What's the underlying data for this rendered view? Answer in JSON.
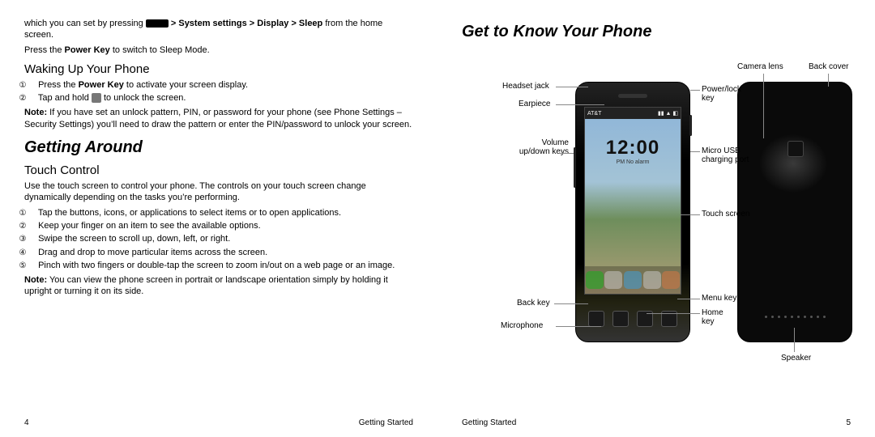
{
  "left": {
    "intro_pre": "which you can set by pressing ",
    "intro_path": " > System settings > Display > Sleep ",
    "intro_post": "from the home screen.",
    "press_power": "Press the Power Key to switch to Sleep Mode.",
    "wake_h": "Waking Up Your Phone",
    "wake1_pre": "Press the ",
    "wake1_bold": "Power Key",
    "wake1_post": " to activate your screen display.",
    "wake2_pre": "Tap and hold ",
    "wake2_post": " to unlock the screen.",
    "note_bold": "Note:",
    "note_body": " If you have set an unlock pattern, PIN, or password for your phone (see Phone Settings – Security Settings) you’ll need to draw the pattern or enter the PIN/password to unlock your screen.",
    "getting_around": "Getting Around",
    "touch_h": "Touch Control",
    "touch_p": "Use the touch screen to control your phone. The controls on your touch screen change dynamically depending on the tasks you’re performing.",
    "t1": "Tap the buttons, icons, or applications to select items or to open applications.",
    "t2": "Keep your finger on an item to see the available options.",
    "t3": "Swipe the screen to scroll up, down, left, or right.",
    "t4": "Drag and drop to move particular items across the screen.",
    "t5": "Pinch with two fingers or double-tap the screen to zoom in/out on a web page or an image.",
    "note2_bold": "Note:",
    "note2_body": " You can view the phone screen in portrait or landscape orientation simply by holding it upright or turning it on its side.",
    "pageno": "4",
    "footer": "Getting Started"
  },
  "right": {
    "title": "Get to Know Your Phone",
    "labels": {
      "headset": "Headset jack",
      "earpiece": "Earpiece",
      "volume": "Volume up/down keys",
      "back": "Back key",
      "mic": "Microphone",
      "power": "Power/lock key",
      "usb": "Micro USB charging port",
      "touch": "Touch screen",
      "menu": "Menu key",
      "home": "Home key",
      "camera": "Camera lens",
      "backcover": "Back cover",
      "speaker": "Speaker"
    },
    "phone_status": {
      "left": "AT&T",
      "right": "▮▮ ▲ ◧"
    },
    "phone_clock": "12:00",
    "phone_sub": "PM                           No alarm",
    "footer": "Getting Started",
    "pageno": "5"
  }
}
